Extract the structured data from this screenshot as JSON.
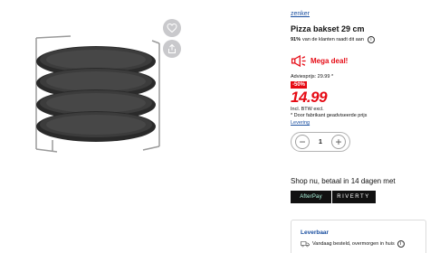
{
  "product": {
    "brand": "zenker",
    "title": "Pizza bakset 29 cm",
    "recommend_percent": "91%",
    "recommend_text": "van de klanten raadt dit aan",
    "deal_label": "Mega deal!",
    "advice_price_label": "Adviesprijs: 29.99 *",
    "discount": "-50%",
    "price": "14.99",
    "vat_note": "Incl. BTW excl.",
    "footnote": "* Door fabrikant geadviseerde prijs",
    "delivery_link": "Levering"
  },
  "quantity": {
    "value": "1",
    "minus": "−",
    "plus": "+"
  },
  "payment": {
    "title": "Shop nu, betaal in 14 dagen met",
    "afterpay": "AfterPay",
    "riverty": "RIVERTY"
  },
  "delivery": {
    "title": "Leverbaar",
    "text": "Vandaag besteld, overmorgen in huis"
  },
  "colors": {
    "accent_red": "#e60a14",
    "link_blue": "#1a4fa0"
  },
  "icons": {
    "wishlist": "heart-icon",
    "share": "share-icon",
    "deal": "megaphone-icon",
    "info": "info-icon",
    "delivery": "truck-icon"
  }
}
